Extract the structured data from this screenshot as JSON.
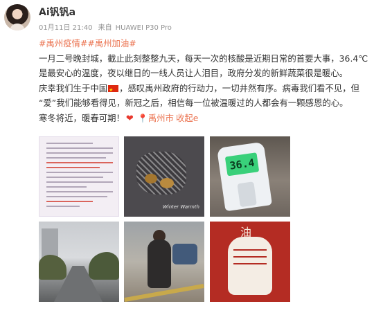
{
  "post": {
    "author": "Ai钒钒a",
    "timestamp": "01月11日 21:40",
    "source_prefix": "来自",
    "source_device": "HUAWEI P30 Pro",
    "hashtag1": "#禹州疫情#",
    "hashtag2": "#禹州加油#",
    "line1": "一月二号晚封城，截止此刻整整九天，每天一次的核酸是近期日常的首要大事，36.4℃",
    "line2": "是最安心的温度，夜以继日的一线人员让人泪目，政府分发的新鲜蔬菜很是暖心。",
    "line3a": "庆幸我们生于中国",
    "line3b": "，感叹禹州政府的行动力，一切井然有序。病毒我们看不见，但",
    "line4": "“爱”我们能够看得见，新冠之后，相信每一位被温暖过的人都会有一颗感恩的心。",
    "line5": "寒冬将近，暖春可期！",
    "heart_icon": "❤",
    "location_icon": "📍",
    "location": "禹州市",
    "collapse_label": "收起e"
  },
  "images": {
    "thermometer_reading": "36.4",
    "photo2_caption": "Winter Warmth",
    "photo6_character": "油"
  },
  "colors": {
    "hashtag": "#eb7350",
    "meta_gray": "#939393",
    "text": "#333333",
    "poster_red": "#b42c23"
  }
}
